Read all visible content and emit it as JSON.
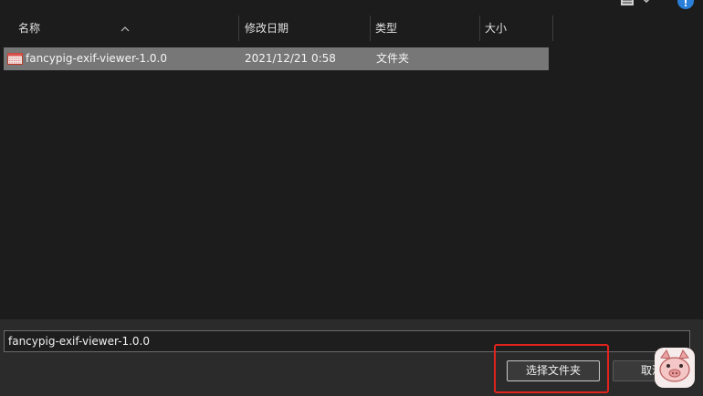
{
  "columns": {
    "name": "名称",
    "modified": "修改日期",
    "type": "类型",
    "size": "大小"
  },
  "files": [
    {
      "name": "fancypig-exif-viewer-1.0.0",
      "modified": "2021/12/21 0:58",
      "type": "文件夹",
      "size": "",
      "selected": true
    }
  ],
  "filename_value": "fancypig-exif-viewer-1.0.0",
  "buttons": {
    "select_folder": "选择文件夹",
    "cancel": "取消"
  },
  "colors": {
    "highlight": "#e0231d",
    "help_accent": "#2a7fd8",
    "selected_row": "#777777"
  },
  "icons": {
    "view": "view-menu-icon",
    "help": "help-icon",
    "folder": "folder-icon",
    "sort": "sort-ascending-icon",
    "logo": "pig-logo"
  }
}
